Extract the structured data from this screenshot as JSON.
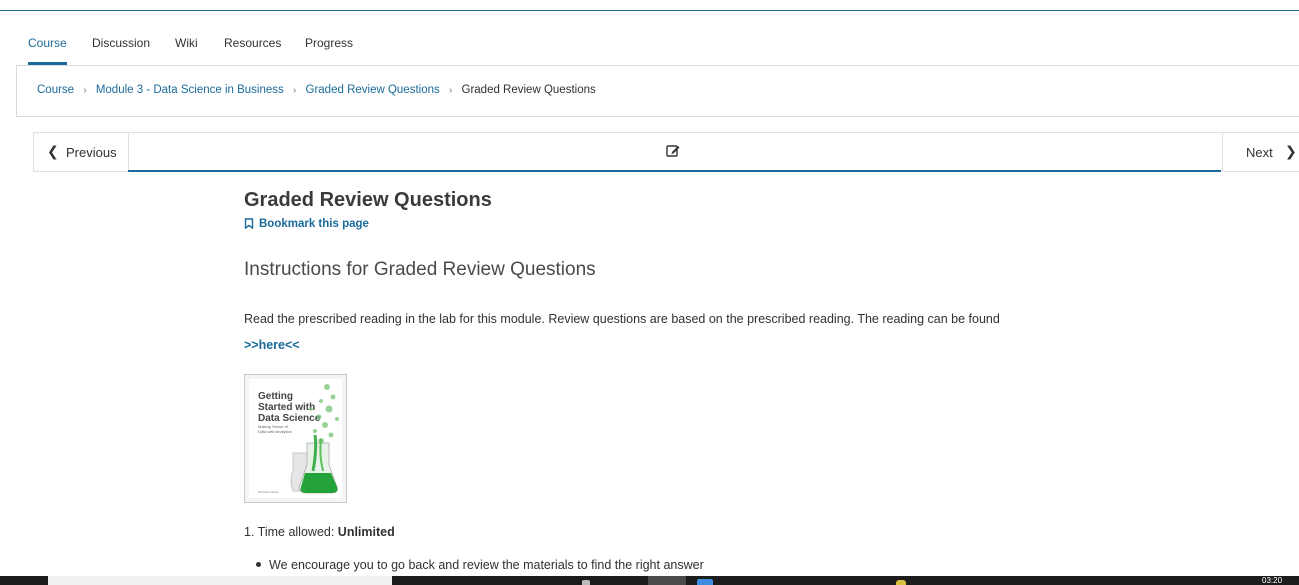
{
  "tabs": [
    {
      "label": "Course",
      "active": true
    },
    {
      "label": "Discussion",
      "active": false
    },
    {
      "label": "Wiki",
      "active": false
    },
    {
      "label": "Resources",
      "active": false
    },
    {
      "label": "Progress",
      "active": false
    }
  ],
  "breadcrumb": {
    "links": [
      "Course",
      "Module 3 - Data Science in Business",
      "Graded Review Questions"
    ],
    "current": "Graded Review Questions"
  },
  "sequence_nav": {
    "previous_label": "Previous",
    "next_label": "Next",
    "unit_icon": "edit-icon"
  },
  "content": {
    "title": "Graded Review Questions",
    "bookmark_label": "Bookmark this page",
    "section_title": "Instructions for Graded Review Questions",
    "paragraph_text": "Read the prescribed reading in the lab for this module. Review questions are based on the prescribed reading. The reading can be found ",
    "paragraph_link": ">>here<<",
    "book_cover": {
      "title_line1": "Getting",
      "title_line2": "Started with",
      "title_line3": "Data Science",
      "subtitle_line1": "Making Sense of",
      "subtitle_line2": "Data with Analytics",
      "author": "Murtaza Haider"
    },
    "list_item_1_prefix": "1. Time allowed: ",
    "list_item_1_value": "Unlimited",
    "bullet_1": "We encourage you to go back and review the materials to find the right answer"
  },
  "taskbar": {
    "clock": "03:20"
  },
  "colors": {
    "accent": "#1a6b9a",
    "text": "#313131",
    "border": "#d9d9d9"
  }
}
